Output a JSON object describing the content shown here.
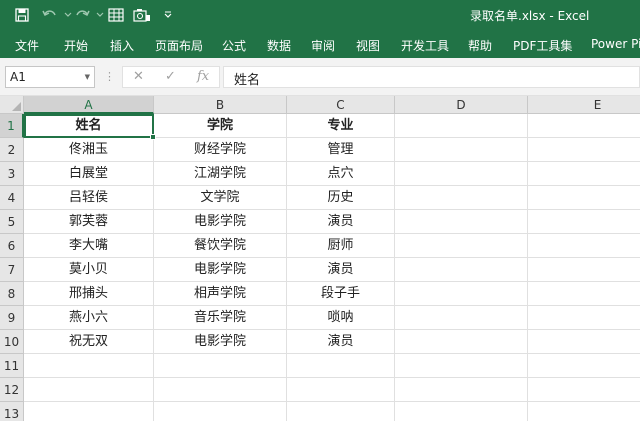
{
  "window": {
    "title": "录取名单.xlsx  -  Excel"
  },
  "quick_access": [
    "save-icon",
    "undo-icon",
    "redo-icon",
    "form-icon",
    "camera-icon",
    "customize-icon"
  ],
  "ribbon": {
    "tabs": [
      {
        "label": "文件",
        "name": "tab-file"
      },
      {
        "label": "开始",
        "name": "tab-home"
      },
      {
        "label": "插入",
        "name": "tab-insert"
      },
      {
        "label": "页面布局",
        "name": "tab-page-layout"
      },
      {
        "label": "公式",
        "name": "tab-formulas"
      },
      {
        "label": "数据",
        "name": "tab-data"
      },
      {
        "label": "审阅",
        "name": "tab-review"
      },
      {
        "label": "视图",
        "name": "tab-view"
      },
      {
        "label": "开发工具",
        "name": "tab-developer"
      },
      {
        "label": "帮助",
        "name": "tab-help"
      },
      {
        "label": "PDF工具集",
        "name": "tab-pdf-tools"
      },
      {
        "label": "Power Pivot",
        "name": "tab-power-pivot"
      }
    ]
  },
  "formula_bar": {
    "name_box": "A1",
    "cancel_glyph": "✕",
    "enter_glyph": "✓",
    "function_glyph": "fx",
    "content": "姓名"
  },
  "sheet": {
    "columns": [
      "A",
      "B",
      "C",
      "D",
      "E"
    ],
    "rows": [
      "1",
      "2",
      "3",
      "4",
      "5",
      "6",
      "7",
      "8",
      "9",
      "10",
      "11",
      "12",
      "13"
    ],
    "cells": [
      [
        "姓名",
        "学院",
        "专业"
      ],
      [
        "佟湘玉",
        "财经学院",
        "管理"
      ],
      [
        "白展堂",
        "江湖学院",
        "点穴"
      ],
      [
        "吕轻侯",
        "文学院",
        "历史"
      ],
      [
        "郭芙蓉",
        "电影学院",
        "演员"
      ],
      [
        "李大嘴",
        "餐饮学院",
        "厨师"
      ],
      [
        "莫小贝",
        "电影学院",
        "演员"
      ],
      [
        "邢捕头",
        "相声学院",
        "段子手"
      ],
      [
        "燕小六",
        "音乐学院",
        "唢呐"
      ],
      [
        "祝无双",
        "电影学院",
        "演员"
      ]
    ],
    "active_cell": "A1"
  },
  "colors": {
    "accent": "#217346",
    "gridline": "#e0e0e0",
    "header_bg": "#e6e6e6"
  }
}
